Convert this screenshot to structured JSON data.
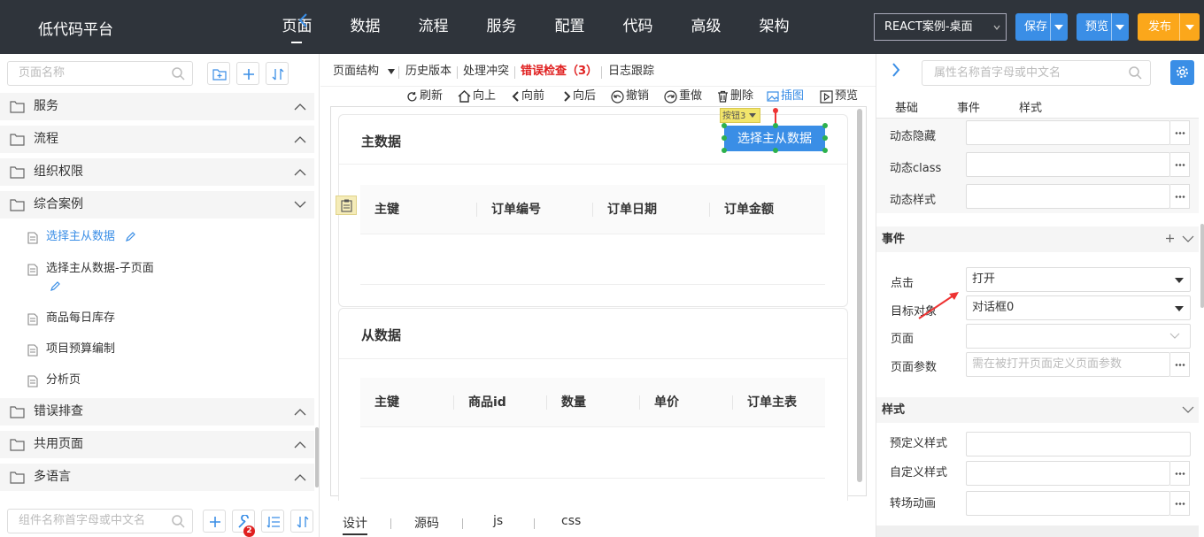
{
  "app": {
    "title": "低代码平台"
  },
  "nav": {
    "items": [
      "页面",
      "数据",
      "流程",
      "服务",
      "配置",
      "代码",
      "高级",
      "架构"
    ],
    "active": "页面"
  },
  "toolbar": {
    "app_select": "REACT案例-桌面",
    "save": "保存",
    "preview": "预览",
    "publish": "发布"
  },
  "sidebar": {
    "search_placeholder": "页面名称",
    "groups": [
      "服务",
      "流程",
      "组织权限",
      "综合案例"
    ],
    "items": [
      "选择主从数据",
      "选择主从数据-子页面",
      "商品每日库存",
      "项目预算编制",
      "分析页"
    ],
    "groups_after": [
      "错误排查",
      "共用页面",
      "多语言"
    ],
    "component_search_placeholder": "组件名称首字母或中文名",
    "badge_count": "2"
  },
  "editor": {
    "header_tabs": {
      "page_structure": "页面结构",
      "history": "历史版本",
      "conflict": "处理冲突",
      "error_check": "错误检查",
      "error_count": "（3）",
      "log": "日志跟踪"
    },
    "tools": [
      "刷新",
      "向上",
      "向前",
      "向后",
      "撤销",
      "重做",
      "删除",
      "插图",
      "预览"
    ],
    "master": {
      "title": "主数据",
      "button": "选择主从数据",
      "button_tag": "按钮3",
      "columns": [
        "主键",
        "订单编号",
        "订单日期",
        "订单金额"
      ]
    },
    "detail": {
      "title": "从数据",
      "columns": [
        "主键",
        "商品id",
        "数量",
        "单价",
        "订单主表"
      ]
    },
    "bottom_tabs": [
      "设计",
      "源码",
      "js",
      "css"
    ]
  },
  "props": {
    "search_placeholder": "属性名称首字母或中文名",
    "tabs": [
      "基础",
      "事件",
      "样式"
    ],
    "dynamic": {
      "hide": "动态隐藏",
      "class": "动态class",
      "style": "动态样式"
    },
    "events": {
      "title": "事件",
      "click_label": "点击",
      "click_value": "打开",
      "target_label": "目标对象",
      "target_value": "对话框0",
      "page_label": "页面",
      "params_label": "页面参数",
      "params_placeholder": "需在被打开页面定义页面参数"
    },
    "styles": {
      "title": "样式",
      "predefined": "预定义样式",
      "custom": "自定义样式",
      "transition": "转场动画"
    }
  },
  "colors": {
    "topbar": "#2f343b",
    "primary": "#3a8ee6",
    "publish": "#fba71b",
    "error": "#e02020"
  }
}
